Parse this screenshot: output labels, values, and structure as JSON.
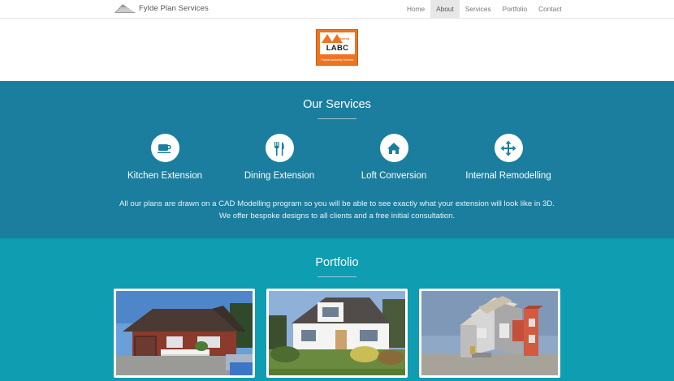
{
  "brand": {
    "name": "Fylde Plan Services"
  },
  "nav": [
    {
      "label": "Home",
      "active": false
    },
    {
      "label": "About",
      "active": true
    },
    {
      "label": "Services",
      "active": false
    },
    {
      "label": "Portfolio",
      "active": false
    },
    {
      "label": "Contact",
      "active": false
    }
  ],
  "logo": {
    "main": "LABC",
    "registered": "registered",
    "sub": "Partner Authority Scheme"
  },
  "services": {
    "title": "Our Services",
    "items": [
      {
        "label": "Kitchen Extension",
        "icon": "coffee-cup-icon"
      },
      {
        "label": "Dining Extension",
        "icon": "cutlery-icon"
      },
      {
        "label": "Loft Conversion",
        "icon": "home-icon"
      },
      {
        "label": "Internal Remodelling",
        "icon": "move-arrows-icon"
      }
    ],
    "description": "All our plans are drawn on a CAD Modelling program so you will be able to see exactly what your extension will look like in 3D. We offer bespoke designs to all clients and a free initial consultation."
  },
  "portfolio": {
    "title": "Portfolio"
  },
  "colors": {
    "services_bg": "#1b7e9e",
    "portfolio_bg": "#0e9db1",
    "accent": "#ee7421"
  }
}
